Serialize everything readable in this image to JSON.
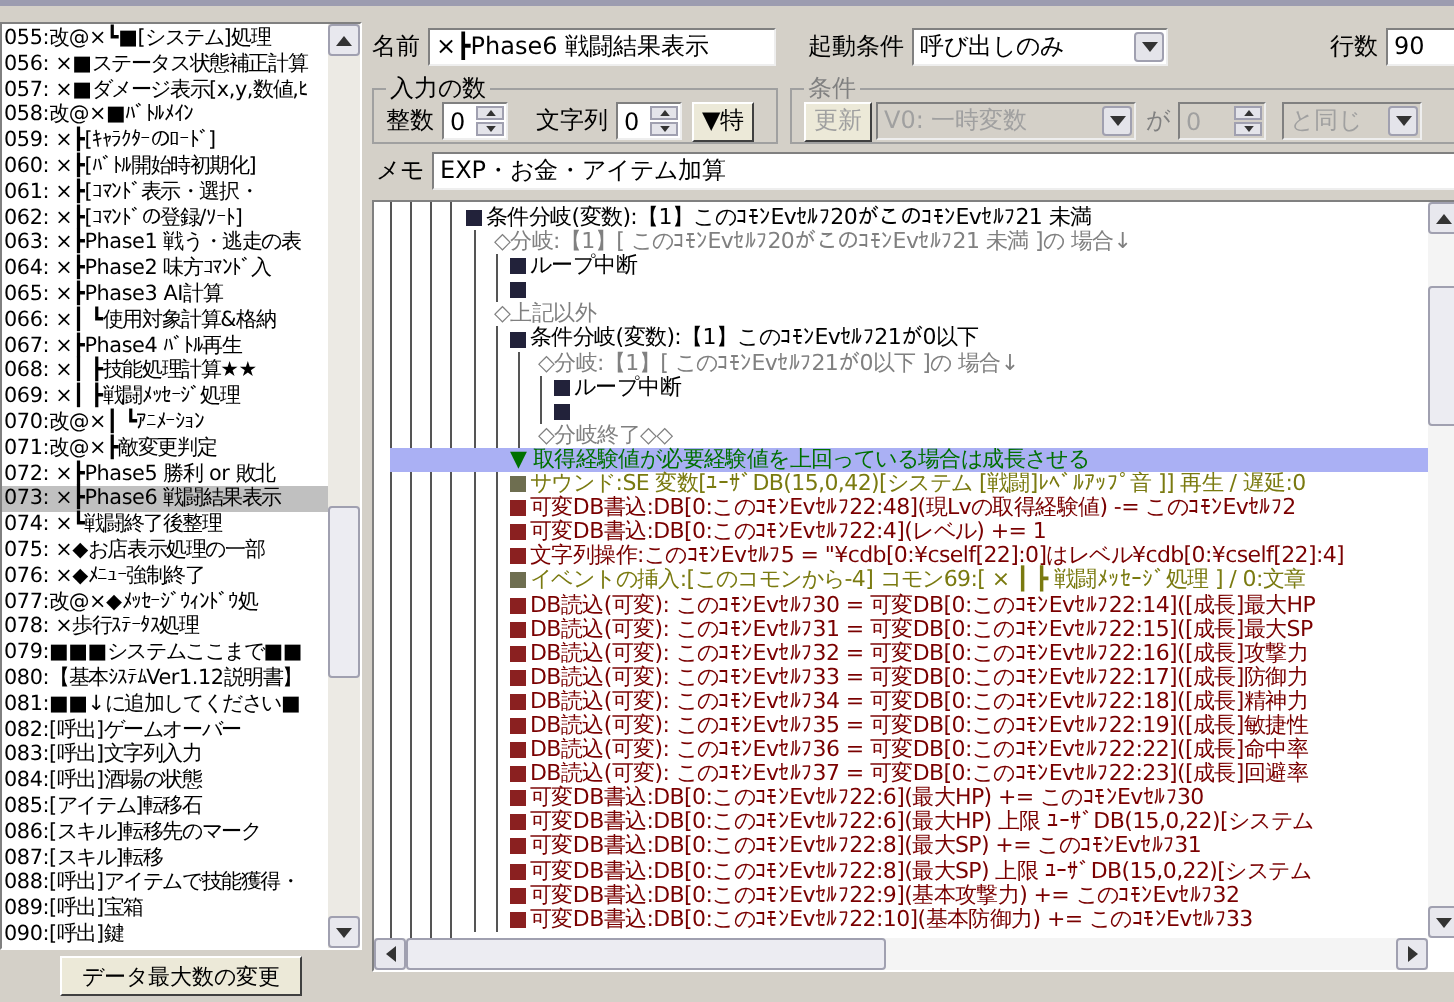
{
  "event_list": {
    "items": [
      {
        "label": "055:改@×┗■[システム]処理",
        "selected": false
      },
      {
        "label": "056: ×■ステータス状態補正計算",
        "selected": false
      },
      {
        "label": "057: ×■ダメージ表示[x,y,数値,ﾋ",
        "selected": false
      },
      {
        "label": "058:改@×■ﾊﾞﾄﾙﾒｲﾝ",
        "selected": false
      },
      {
        "label": "059: ×┣[ｷｬﾗｸﾀｰのﾛｰﾄﾞ]",
        "selected": false
      },
      {
        "label": "060: ×┣[ﾊﾞﾄﾙ開始時初期化]",
        "selected": false
      },
      {
        "label": "061: ×┣[ｺﾏﾝﾄﾞ表示・選択・",
        "selected": false
      },
      {
        "label": "062: ×┣[ｺﾏﾝﾄﾞの登録/ｿｰﾄ]",
        "selected": false
      },
      {
        "label": "063: ×┣Phase1 戦う・逃走の表",
        "selected": false
      },
      {
        "label": "064: ×┣Phase2 味方ｺﾏﾝﾄﾞ入",
        "selected": false
      },
      {
        "label": "065: ×┣Phase3 AI計算",
        "selected": false
      },
      {
        "label": "066: ×┃ ┗使用対象計算&格納",
        "selected": false
      },
      {
        "label": "067: ×┣Phase4 ﾊﾞﾄﾙ再生",
        "selected": false
      },
      {
        "label": "068: ×┃ ┣技能処理計算★★",
        "selected": false
      },
      {
        "label": "069: ×┃ ┣戦闘ﾒｯｾｰｼﾞ処理",
        "selected": false
      },
      {
        "label": "070:改@×┃ ┗ｱﾆﾒｰｼｮﾝ",
        "selected": false
      },
      {
        "label": "071:改@×┣敵変更判定",
        "selected": false
      },
      {
        "label": "072: ×┣Phase5 勝利 or 敗北",
        "selected": false
      },
      {
        "label": "073: ×┣Phase6 戦闘結果表示",
        "selected": true
      },
      {
        "label": "074: ×┗戦闘終了後整理",
        "selected": false
      },
      {
        "label": "075: ×◆お店表示処理の一部",
        "selected": false
      },
      {
        "label": "076: ×◆ﾒﾆｭｰ強制終了",
        "selected": false
      },
      {
        "label": "077:改@×◆ﾒｯｾｰｼﾞｳｨﾝﾄﾞｳ処",
        "selected": false
      },
      {
        "label": "078: ×歩行ｽﾃｰﾀｽ処理",
        "selected": false
      },
      {
        "label": "079:■■■システムここまで■■",
        "selected": false
      },
      {
        "label": "080:【基本ｼｽﾃﾑVer1.12説明書】",
        "selected": false
      },
      {
        "label": "081:■■↓に追加してください■",
        "selected": false
      },
      {
        "label": "082:[呼出]ゲームオーバー",
        "selected": false
      },
      {
        "label": "083:[呼出]文字列入力",
        "selected": false
      },
      {
        "label": "084:[呼出]酒場の状態",
        "selected": false
      },
      {
        "label": "085:[アイテム]転移石",
        "selected": false
      },
      {
        "label": "086:[スキル]転移先のマーク",
        "selected": false
      },
      {
        "label": "087:[スキル]転移",
        "selected": false
      },
      {
        "label": "088:[呼出]アイテムで技能獲得・",
        "selected": false
      },
      {
        "label": "089:[呼出]宝箱",
        "selected": false
      },
      {
        "label": "090:[呼出]鍵",
        "selected": false
      }
    ]
  },
  "max_data_button": "データ最大数の変更",
  "name_field": {
    "label": "名前",
    "value": "×┣Phase6 戦闘結果表示"
  },
  "trigger": {
    "label": "起動条件",
    "value": "呼び出しのみ"
  },
  "line_count": {
    "label": "行数",
    "value": "90"
  },
  "input_count": {
    "title": "入力の数",
    "integer": {
      "label": "整数",
      "value": "0"
    },
    "string": {
      "label": "文字列",
      "value": "0"
    },
    "special_button": "▼特"
  },
  "condition": {
    "title": "条件",
    "disabled": true,
    "update_button": "更新",
    "variable": "V0: 一時変数",
    "joiner": "が",
    "value": "0",
    "comparison": "と同じ"
  },
  "memo": {
    "label": "メモ",
    "value": "EXP・お金・アイテム加算"
  },
  "code": {
    "lines": [
      {
        "kind": "command",
        "text": "条件分岐(変数):【1】このｺﾓﾝEvｾﾙﾌ20がこのｺﾓﾝEvｾﾙﾌ21 未満",
        "selected": false,
        "children": [
          {
            "kind": "branch",
            "text": "◇分岐:【1】[ このｺﾓﾝEvｾﾙﾌ20がこのｺﾓﾝEvｾﾙﾌ21 未満 ]の 場合↓",
            "selected": false,
            "children": [
              {
                "kind": "command",
                "text": "ループ中断",
                "selected": false
              },
              {
                "kind": "command",
                "selected": false
              }
            ]
          },
          {
            "kind": "branch",
            "text": "◇上記以外",
            "selected": false,
            "children": [
              {
                "kind": "command",
                "text": "条件分岐(変数):【1】このｺﾓﾝEvｾﾙﾌ21が0以下",
                "selected": false,
                "children": [
                  {
                    "kind": "branch",
                    "text": "◇分岐:【1】[ このｺﾓﾝEvｾﾙﾌ21が0以下 ]の 場合↓",
                    "selected": false,
                    "children": [
                      {
                        "kind": "command",
                        "text": "ループ中断",
                        "selected": false
                      },
                      {
                        "kind": "command",
                        "selected": false
                      }
                    ]
                  },
                  {
                    "kind": "branch",
                    "text": "◇分岐終了◇◇",
                    "selected": false
                  }
                ]
              },
              {
                "kind": "comment",
                "text": "▼ 取得経験値が必要経験値を上回っている場合は成長させる",
                "selected": true
              },
              {
                "kind": "sound",
                "text": "サウンド:SE 変数[ﾕｰｻﾞDB(15,0,42)[システム [戦闘]ﾚﾍﾞﾙｱｯﾌﾟ音 ]] 再生 / 遅延:0",
                "selected": false
              },
              {
                "kind": "db",
                "text": "可変DB書込:DB[0:このｺﾓﾝEvｾﾙﾌ22:48](現Lvの取得経験値) -= このｺﾓﾝEvｾﾙﾌ2",
                "selected": false
              },
              {
                "kind": "db",
                "text": "可変DB書込:DB[0:このｺﾓﾝEvｾﾙﾌ22:4](レベル) += 1",
                "selected": false
              },
              {
                "kind": "db",
                "text": "文字列操作:このｺﾓﾝEvｾﾙﾌ5 = \"¥cdb[0:¥cself[22]:0]はレベル¥cdb[0:¥cself[22]:4]",
                "selected": false
              },
              {
                "kind": "sound",
                "text": "イベントの挿入:[このコモンから-4] コモン69:[ × ┃ ┣ 戦闘ﾒｯｾｰｼﾞ処理 ] / 0:文章",
                "selected": false
              },
              {
                "kind": "db",
                "text": "DB読込(可変): このｺﾓﾝEvｾﾙﾌ30 = 可変DB[0:このｺﾓﾝEvｾﾙﾌ22:14]([成長]最大HP",
                "selected": false
              },
              {
                "kind": "db",
                "text": "DB読込(可変): このｺﾓﾝEvｾﾙﾌ31 = 可変DB[0:このｺﾓﾝEvｾﾙﾌ22:15]([成長]最大SP",
                "selected": false
              },
              {
                "kind": "db",
                "text": "DB読込(可変): このｺﾓﾝEvｾﾙﾌ32 = 可変DB[0:このｺﾓﾝEvｾﾙﾌ22:16]([成長]攻撃力",
                "selected": false
              },
              {
                "kind": "db",
                "text": "DB読込(可変): このｺﾓﾝEvｾﾙﾌ33 = 可変DB[0:このｺﾓﾝEvｾﾙﾌ22:17]([成長]防御力",
                "selected": false
              },
              {
                "kind": "db",
                "text": "DB読込(可変): このｺﾓﾝEvｾﾙﾌ34 = 可変DB[0:このｺﾓﾝEvｾﾙﾌ22:18]([成長]精神力",
                "selected": false
              },
              {
                "kind": "db",
                "text": "DB読込(可変): このｺﾓﾝEvｾﾙﾌ35 = 可変DB[0:このｺﾓﾝEvｾﾙﾌ22:19]([成長]敏捷性",
                "selected": false
              },
              {
                "kind": "db",
                "text": "DB読込(可変): このｺﾓﾝEvｾﾙﾌ36 = 可変DB[0:このｺﾓﾝEvｾﾙﾌ22:22]([成長]命中率",
                "selected": false
              },
              {
                "kind": "db",
                "text": "DB読込(可変): このｺﾓﾝEvｾﾙﾌ37 = 可変DB[0:このｺﾓﾝEvｾﾙﾌ22:23]([成長]回避率",
                "selected": false
              },
              {
                "kind": "db",
                "text": "可変DB書込:DB[0:このｺﾓﾝEvｾﾙﾌ22:6](最大HP) += このｺﾓﾝEvｾﾙﾌ30",
                "selected": false
              },
              {
                "kind": "db",
                "text": "可変DB書込:DB[0:このｺﾓﾝEvｾﾙﾌ22:6](最大HP) 上限 ﾕｰｻﾞDB(15,0,22)[システム",
                "selected": false
              },
              {
                "kind": "db",
                "text": "可変DB書込:DB[0:このｺﾓﾝEvｾﾙﾌ22:8](最大SP) += このｺﾓﾝEvｾﾙﾌ31",
                "selected": false
              },
              {
                "kind": "db",
                "text": "可変DB書込:DB[0:このｺﾓﾝEvｾﾙﾌ22:8](最大SP) 上限 ﾕｰｻﾞDB(15,0,22)[システム",
                "selected": false
              },
              {
                "kind": "db",
                "text": "可変DB書込:DB[0:このｺﾓﾝEvｾﾙﾌ22:9](基本攻撃力) += このｺﾓﾝEvｾﾙﾌ32",
                "selected": false
              },
              {
                "kind": "db",
                "text": "可変DB書込:DB[0:このｺﾓﾝEvｾﾙﾌ22:10](基本防御力) += このｺﾓﾝEvｾﾙﾌ33",
                "selected": false
              }
            ]
          }
        ]
      }
    ]
  }
}
